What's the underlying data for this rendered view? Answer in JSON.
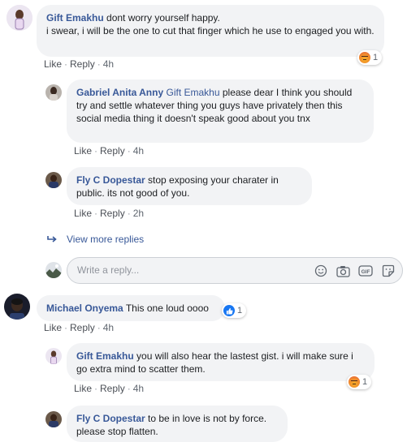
{
  "comments": [
    {
      "author": "Gift Emakhu",
      "text": "dont worry yourself happy.\ni swear, i will be the one to cut that finger which he use to engaged you with.",
      "like": "Like",
      "reply": "Reply",
      "time": "4h",
      "reaction_count": "1",
      "reaction": "angry"
    },
    {
      "author": "Gabriel Anita Anny",
      "mention": "Gift Emakhu",
      "text": "please dear I think you should try and settle whatever thing you guys have privately then this social media thing it doesn't speak good about you tnx",
      "like": "Like",
      "reply": "Reply",
      "time": "4h"
    },
    {
      "author": "Fly C Dopestar",
      "text": "stop exposing your charater in public. its not good of you.",
      "like": "Like",
      "reply": "Reply",
      "time": "2h"
    },
    {
      "author": "Michael Onyema",
      "text": "This one loud oooo",
      "like": "Like",
      "reply": "Reply",
      "time": "4h",
      "reaction_count": "1",
      "reaction": "like"
    },
    {
      "author": "Gift Emakhu",
      "text": "you will also hear the lastest gist. i will make sure i go extra mind to scatter them.",
      "like": "Like",
      "reply": "Reply",
      "time": "4h",
      "reaction_count": "1",
      "reaction": "angry"
    },
    {
      "author": "Fly C Dopestar",
      "text": "to be in love is not by force. please stop flatten."
    }
  ],
  "view_more": "View more replies",
  "reply_input": {
    "placeholder": "Write a reply..."
  },
  "icons": [
    "emoji-icon",
    "camera-icon",
    "gif-icon",
    "sticker-icon",
    "reply-arrow-icon"
  ],
  "colors": {
    "name": "#385898",
    "bubble": "#f2f3f5",
    "meta": "#606770"
  }
}
